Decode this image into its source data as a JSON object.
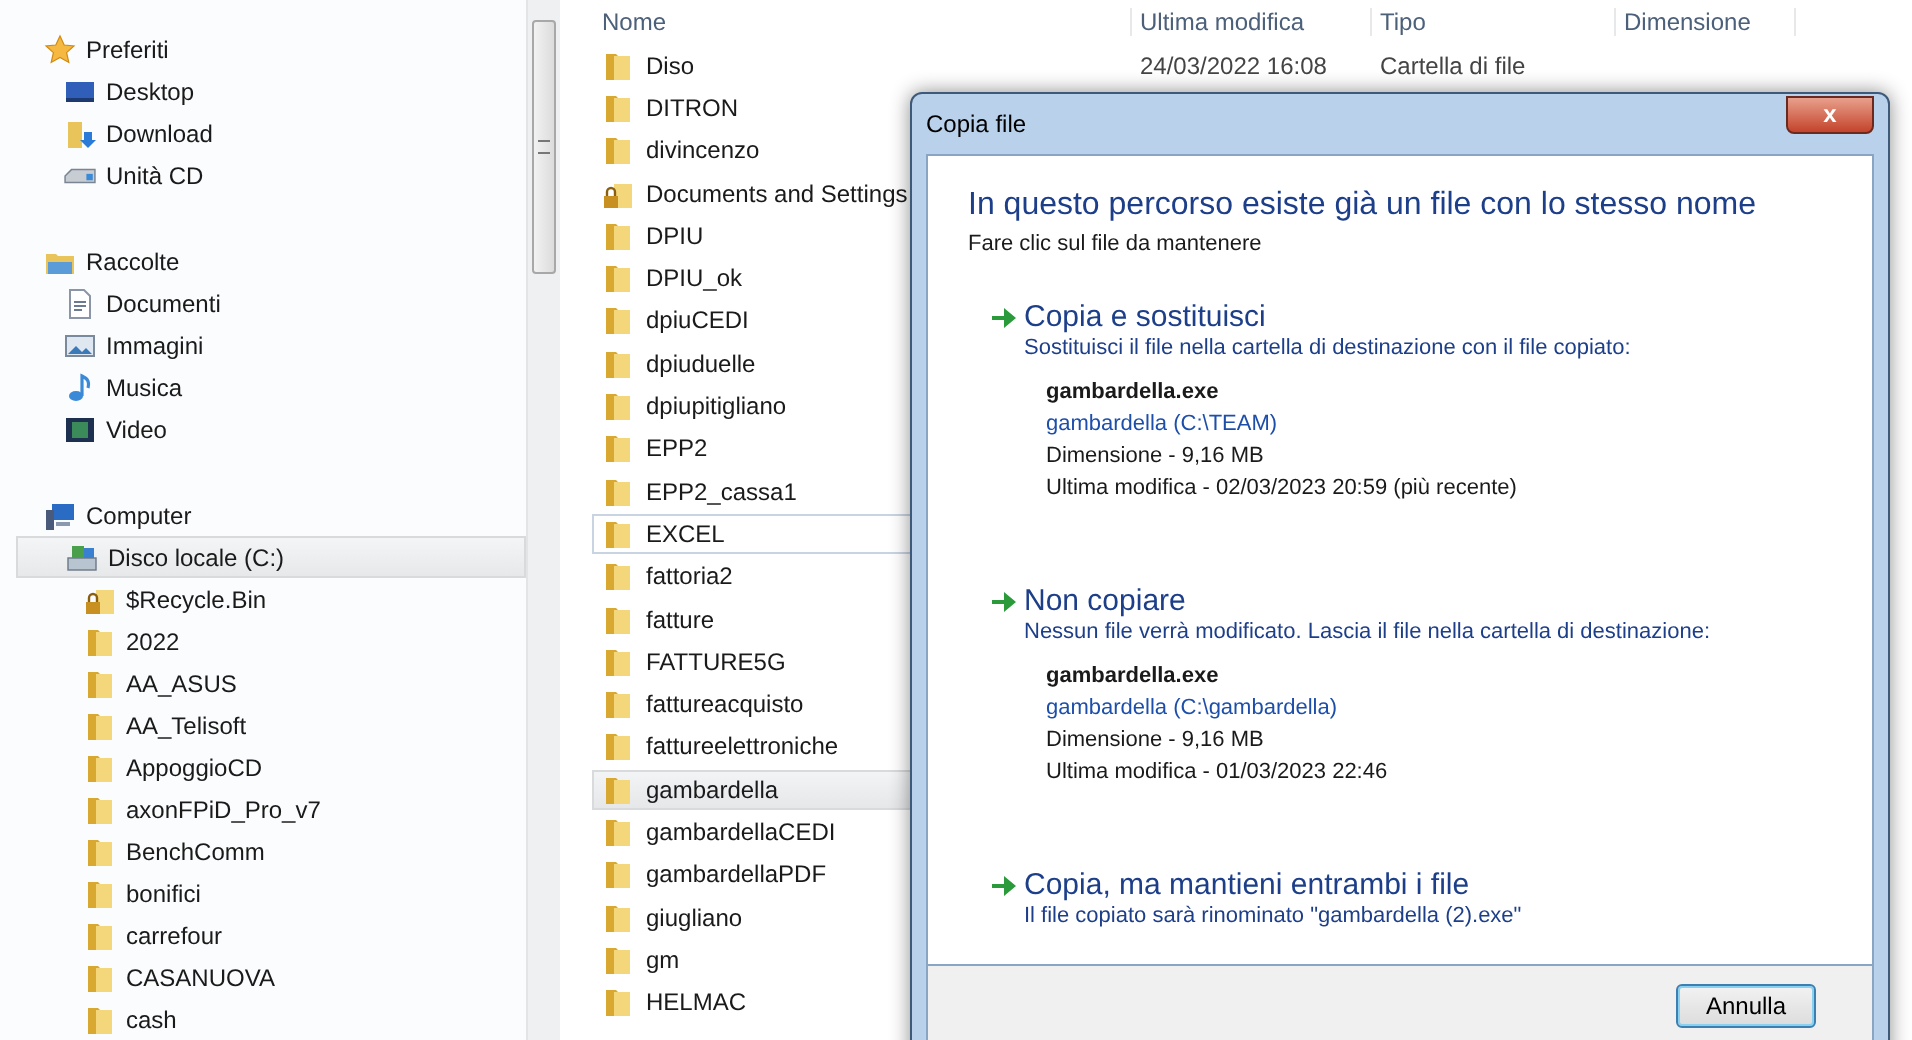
{
  "sidebar": {
    "sections": [
      {
        "label": "Preferiti",
        "selected": false,
        "children": [
          {
            "label": "Desktop",
            "selected": false
          },
          {
            "label": "Download",
            "selected": false
          },
          {
            "label": "Unità CD",
            "selected": false
          }
        ]
      },
      {
        "label": "Raccolte",
        "selected": false,
        "children": [
          {
            "label": "Documenti",
            "selected": false
          },
          {
            "label": "Immagini",
            "selected": false
          },
          {
            "label": "Musica",
            "selected": false
          },
          {
            "label": "Video",
            "selected": false
          }
        ]
      },
      {
        "label": "Computer",
        "selected": false,
        "children": [
          {
            "label": "Disco locale (C:)",
            "selected": true,
            "children": [
              {
                "label": "$Recycle.Bin",
                "locked": true,
                "selected": false
              },
              {
                "label": "2022",
                "locked": false,
                "selected": false
              },
              {
                "label": "AA_ASUS",
                "locked": false,
                "selected": false
              },
              {
                "label": "AA_Telisoft",
                "locked": false,
                "selected": false
              },
              {
                "label": "AppoggioCD",
                "locked": false,
                "selected": false
              },
              {
                "label": "axonFPiD_Pro_v7",
                "locked": false,
                "selected": false
              },
              {
                "label": "BenchComm",
                "locked": false,
                "selected": false
              },
              {
                "label": "bonifici",
                "locked": false,
                "selected": false
              },
              {
                "label": "carrefour",
                "locked": false,
                "selected": false
              },
              {
                "label": "CASANUOVA",
                "locked": false,
                "selected": false
              },
              {
                "label": "cash",
                "locked": false,
                "selected": false
              }
            ]
          }
        ]
      }
    ]
  },
  "file_list": {
    "columns": [
      "Nome",
      "Ultima modifica",
      "Tipo",
      "Dimensione"
    ],
    "rows": [
      {
        "name": "Diso",
        "modified": "24/03/2022 16:08",
        "type": "Cartella di file",
        "locked": false,
        "selected": false,
        "hovered": false
      },
      {
        "name": "DITRON",
        "locked": false,
        "selected": false,
        "hovered": false
      },
      {
        "name": "divincenzo",
        "locked": false,
        "selected": false,
        "hovered": false
      },
      {
        "name": "Documents and Settings",
        "locked": true,
        "selected": false,
        "hovered": false
      },
      {
        "name": "DPIU",
        "locked": false,
        "selected": false,
        "hovered": false
      },
      {
        "name": "DPIU_ok",
        "locked": false,
        "selected": false,
        "hovered": false
      },
      {
        "name": "dpiuCEDI",
        "locked": false,
        "selected": false,
        "hovered": false
      },
      {
        "name": "dpiuduelle",
        "locked": false,
        "selected": false,
        "hovered": false
      },
      {
        "name": "dpiupitigliano",
        "locked": false,
        "selected": false,
        "hovered": false
      },
      {
        "name": "EPP2",
        "locked": false,
        "selected": false,
        "hovered": false
      },
      {
        "name": "EPP2_cassa1",
        "locked": false,
        "selected": false,
        "hovered": false
      },
      {
        "name": "EXCEL",
        "locked": false,
        "selected": false,
        "hovered": true
      },
      {
        "name": "fattoria2",
        "locked": false,
        "selected": false,
        "hovered": false
      },
      {
        "name": "fatture",
        "locked": false,
        "selected": false,
        "hovered": false
      },
      {
        "name": "FATTURE5G",
        "locked": false,
        "selected": false,
        "hovered": false
      },
      {
        "name": "fattureacquisto",
        "locked": false,
        "selected": false,
        "hovered": false
      },
      {
        "name": "fattureelettroniche",
        "locked": false,
        "selected": false,
        "hovered": false
      },
      {
        "name": "gambardella",
        "locked": false,
        "selected": true,
        "hovered": false
      },
      {
        "name": "gambardellaCEDI",
        "locked": false,
        "selected": false,
        "hovered": false
      },
      {
        "name": "gambardellaPDF",
        "locked": false,
        "selected": false,
        "hovered": false
      },
      {
        "name": "giugliano",
        "locked": false,
        "selected": false,
        "hovered": false
      },
      {
        "name": "gm",
        "locked": false,
        "selected": false,
        "hovered": false
      },
      {
        "name": "HELMAC",
        "locked": false,
        "selected": false,
        "hovered": false
      }
    ]
  },
  "dialog": {
    "title": "Copia file",
    "close": "x",
    "heading": "In questo percorso esiste già un file con lo stesso nome",
    "subtitle": "Fare clic sul file da mantenere",
    "options": [
      {
        "title": "Copia e sostituisci",
        "description": "Sostituisci il file nella cartella di destinazione con il file copiato:",
        "details": {
          "name": "gambardella.exe",
          "location": "gambardella (C:\\TEAM)",
          "size": "Dimensione - 9,16 MB",
          "modified": "Ultima modifica - 02/03/2023 20:59 (più recente)"
        }
      },
      {
        "title": "Non copiare",
        "description": "Nessun file verrà modificato. Lascia il file nella cartella di destinazione:",
        "details": {
          "name": "gambardella.exe",
          "location": "gambardella (C:\\gambardella)",
          "size": "Dimensione - 9,16 MB",
          "modified": "Ultima modifica - 01/03/2023 22:46"
        }
      },
      {
        "title": "Copia, ma mantieni entrambi i file",
        "description": "Il file copiato sarà rinominato \"gambardella (2).exe\""
      }
    ],
    "buttons": [
      "Annulla"
    ]
  }
}
